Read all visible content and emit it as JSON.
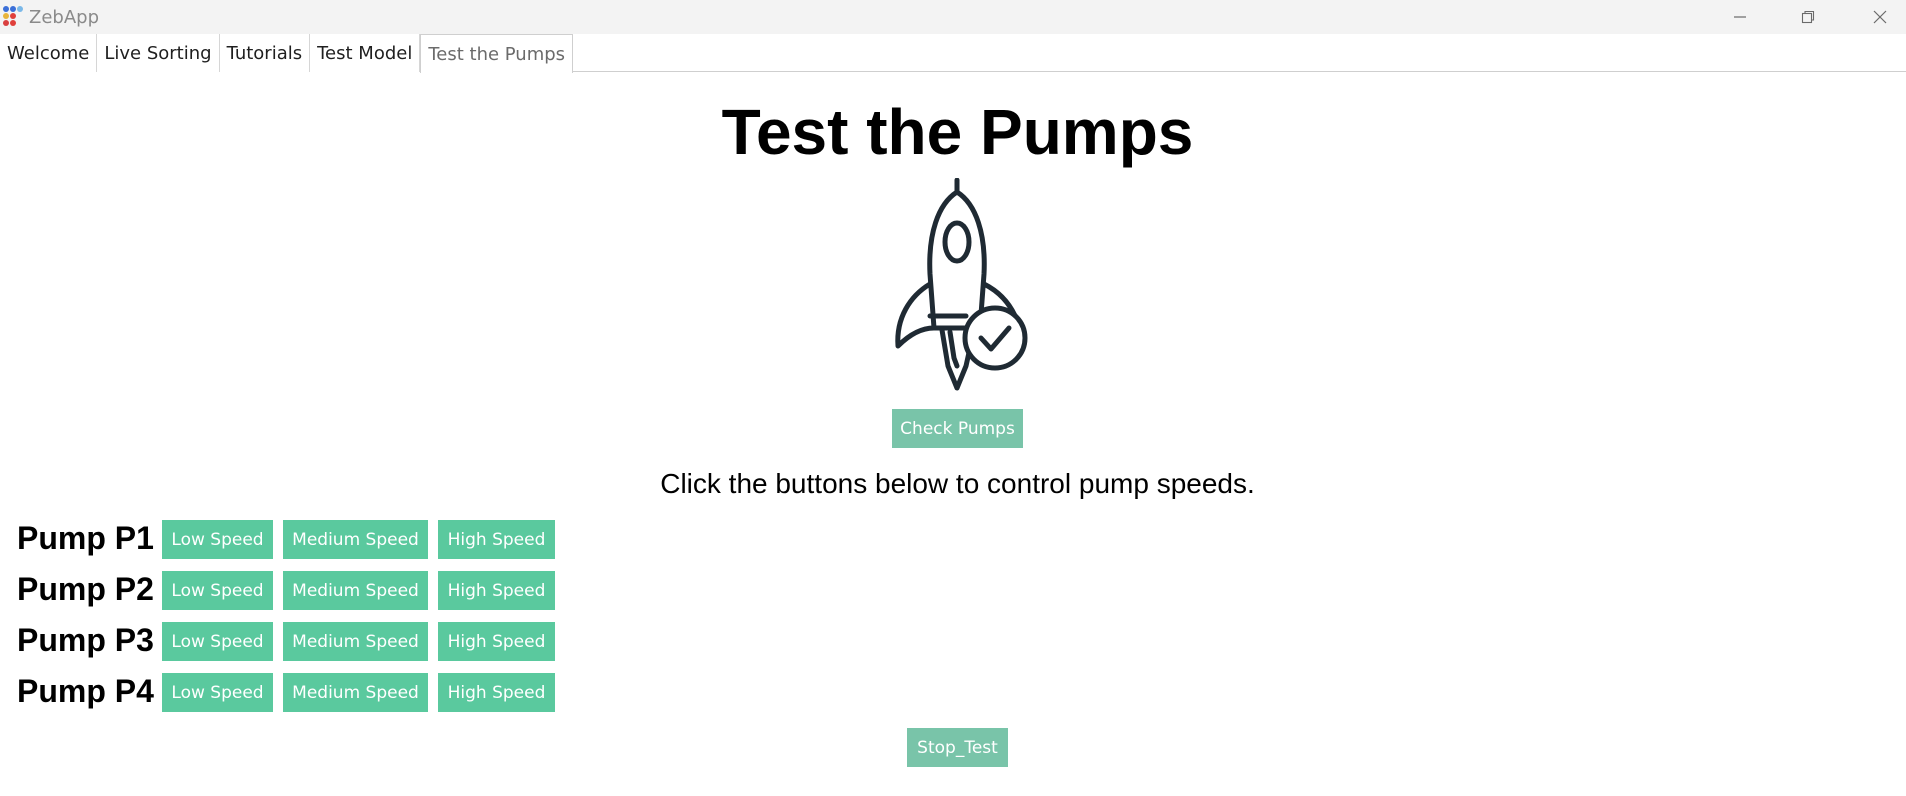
{
  "window": {
    "title": "ZebApp",
    "minimize_icon": "minimize-icon",
    "maximize_icon": "restore-icon",
    "close_icon": "close-icon"
  },
  "tabs": [
    {
      "label": "Welcome"
    },
    {
      "label": "Live Sorting"
    },
    {
      "label": "Tutorials"
    },
    {
      "label": "Test Model"
    },
    {
      "label": "Test the Pumps"
    }
  ],
  "active_tab": "Test the Pumps",
  "main": {
    "title": "Test the Pumps",
    "hero_icon": "rocket-check-icon",
    "check_button": "Check Pumps",
    "instructions": "Click the buttons below to control pump speeds.",
    "pumps": [
      {
        "label": "Pump P1",
        "low": "Low Speed",
        "medium": "Medium Speed",
        "high": "High Speed"
      },
      {
        "label": "Pump P2",
        "low": "Low Speed",
        "medium": "Medium Speed",
        "high": "High Speed"
      },
      {
        "label": "Pump P3",
        "low": "Low Speed",
        "medium": "Medium Speed",
        "high": "High Speed"
      },
      {
        "label": "Pump P4",
        "low": "Low Speed",
        "medium": "Medium Speed",
        "high": "High Speed"
      }
    ],
    "stop_button": "Stop_Test"
  },
  "colors": {
    "button_green": "#5ac99e",
    "button_green_muted": "#79c4a9",
    "icon_dark": "#1f2a33"
  }
}
